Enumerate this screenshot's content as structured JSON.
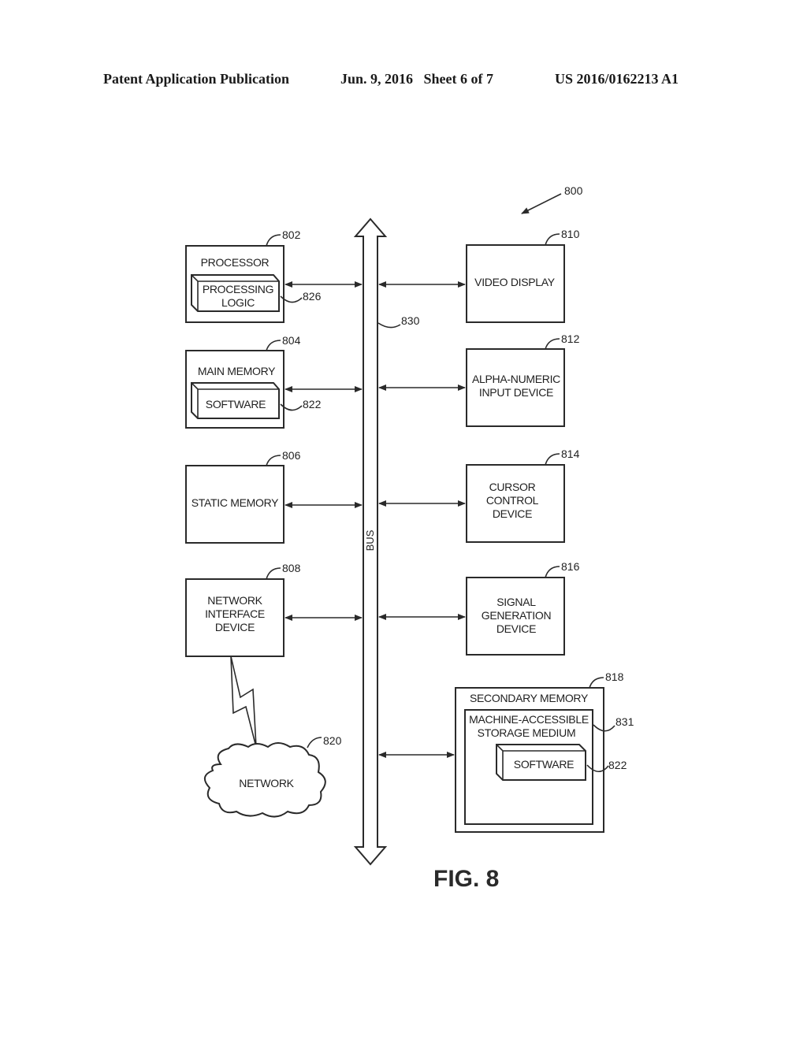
{
  "header": {
    "publication": "Patent Application Publication",
    "date_sheet": "Jun. 9, 2016   Sheet 6 of 7",
    "number": "US 2016/0162213 A1"
  },
  "figure": {
    "label": "FIG. 8",
    "system_ref": "800",
    "bus": {
      "label": "BUS",
      "ref": "830"
    },
    "left_blocks": [
      {
        "ref": "802",
        "title": "PROCESSOR",
        "inner": {
          "lines": [
            "PROCESSING",
            "LOGIC"
          ],
          "ref": "826"
        }
      },
      {
        "ref": "804",
        "title": "MAIN MEMORY",
        "inner": {
          "lines": [
            "SOFTWARE"
          ],
          "ref": "822"
        }
      },
      {
        "ref": "806",
        "lines": [
          "STATIC MEMORY"
        ]
      },
      {
        "ref": "808",
        "lines": [
          "NETWORK",
          "INTERFACE",
          "DEVICE"
        ]
      }
    ],
    "right_blocks": [
      {
        "ref": "810",
        "lines": [
          "VIDEO DISPLAY"
        ]
      },
      {
        "ref": "812",
        "lines": [
          "ALPHA-NUMERIC",
          "INPUT DEVICE"
        ]
      },
      {
        "ref": "814",
        "lines": [
          "CURSOR",
          "CONTROL",
          "DEVICE"
        ]
      },
      {
        "ref": "816",
        "lines": [
          "SIGNAL",
          "GENERATION",
          "DEVICE"
        ]
      }
    ],
    "secondary_memory": {
      "ref": "818",
      "title": "SECONDARY MEMORY",
      "medium": {
        "lines": [
          "MACHINE-ACCESSIBLE",
          "STORAGE MEDIUM"
        ],
        "ref": "831"
      },
      "software": {
        "label": "SOFTWARE",
        "ref": "822"
      }
    },
    "network": {
      "label": "NETWORK",
      "ref": "820"
    }
  }
}
